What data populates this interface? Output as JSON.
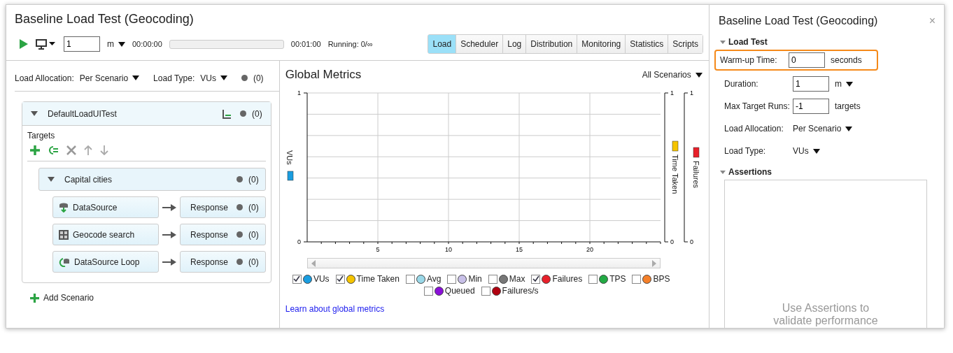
{
  "title": "Baseline Load Test (Geocoding)",
  "toolbar": {
    "duration": "1",
    "unit": "m",
    "elapsed": "00:00:00",
    "progress": {
      "level": 0
    },
    "total": "00:01:00",
    "running": "Running: 0/∞"
  },
  "tabs": [
    {
      "label": "Load",
      "selected": true
    },
    {
      "label": "Scheduler",
      "selected": false
    },
    {
      "label": "Log",
      "selected": false
    },
    {
      "label": "Distribution",
      "selected": false
    },
    {
      "label": "Monitoring",
      "selected": false
    },
    {
      "label": "Statistics",
      "selected": false
    },
    {
      "label": "Scripts",
      "selected": false
    }
  ],
  "load_bar": {
    "allocation_label": "Load Allocation:",
    "allocation": "Per Scenario",
    "type_label": "Load Type:",
    "type": "VUs",
    "count": "(0)"
  },
  "scenario": {
    "name": "DefaultLoadUITest",
    "count": "(0)",
    "expanded": true,
    "targets_label": "Targets",
    "group": {
      "name": "Capital cities",
      "count": "(0)",
      "expanded": true,
      "items": [
        {
          "kind": "datasource",
          "name": "DataSource",
          "output": "Response",
          "count": "(0)"
        },
        {
          "kind": "rest",
          "name": "Geocode search",
          "output": "Response",
          "count": "(0)"
        },
        {
          "kind": "loop",
          "name": "DataSource Loop",
          "output": "Response",
          "count": "(0)"
        }
      ]
    }
  },
  "add_scenario": "Add Scenario",
  "metrics": {
    "title": "Global Metrics",
    "filter": "All Scenarios",
    "chart_data": {
      "type": "line",
      "grid": true,
      "xlim": [
        0,
        25
      ],
      "ylim": [
        0,
        1
      ],
      "xticks": [
        5,
        10,
        15,
        20
      ],
      "yticks": [
        0,
        1
      ]
    },
    "axes": [
      {
        "label": "VUs",
        "color": "#1a9de0"
      },
      {
        "label": "Time Taken",
        "color": "#f5c400",
        "ticks": [
          "1",
          "0"
        ]
      },
      {
        "label": "Failures",
        "color": "#e8202a",
        "ticks": [
          "1",
          "0"
        ]
      }
    ],
    "legend": [
      {
        "label": "VUs",
        "color": "#1a9de0",
        "checked": true
      },
      {
        "label": "Time Taken",
        "color": "#f5c400",
        "checked": true
      },
      {
        "label": "Avg",
        "color": "#9ad8e8",
        "checked": false
      },
      {
        "label": "Min",
        "color": "#c8c0e8",
        "checked": false
      },
      {
        "label": "Max",
        "color": "#777777",
        "checked": false
      },
      {
        "label": "Failures",
        "color": "#e8202a",
        "checked": true
      },
      {
        "label": "TPS",
        "color": "#22aa44",
        "checked": false
      },
      {
        "label": "BPS",
        "color": "#f5802a",
        "checked": false
      },
      {
        "label": "Queued",
        "color": "#8a10d8",
        "checked": false
      },
      {
        "label": "Failures/s",
        "color": "#b00010",
        "checked": false
      }
    ],
    "link": "Learn about global metrics"
  },
  "panel": {
    "title": "Baseline Load Test (Geocoding)",
    "close": "×",
    "section": "Load Test",
    "fields": [
      {
        "kind": "input",
        "label": "Warm-up Time:",
        "value": "0",
        "unit": "seconds",
        "highlighted": true
      },
      {
        "kind": "input-dropdown",
        "label": "Duration:",
        "value": "1",
        "unit": "m",
        "highlighted": false
      },
      {
        "kind": "input",
        "label": "Max Target Runs:",
        "value": "-1",
        "unit": "targets",
        "highlighted": false
      },
      {
        "kind": "dropdown",
        "label": "Load Allocation:",
        "value": "Per Scenario",
        "highlighted": false
      },
      {
        "kind": "dropdown",
        "label": "Load Type:",
        "value": "VUs",
        "highlighted": false
      }
    ],
    "assertions": "Assertions",
    "assertions_hint": "Use Assertions to validate performance"
  }
}
